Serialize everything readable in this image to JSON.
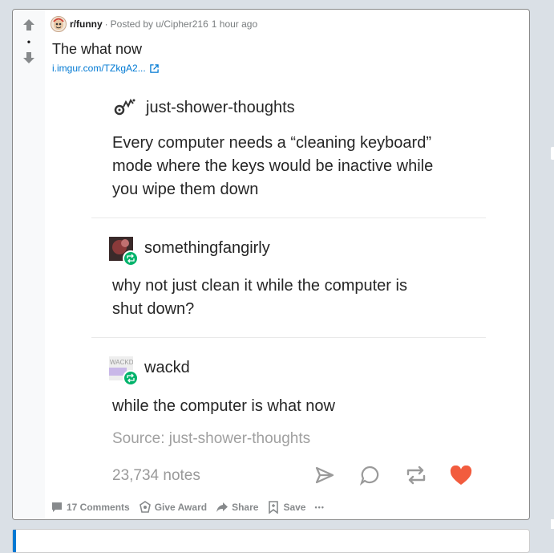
{
  "post": {
    "subreddit": "r/funny",
    "posted_by": "Posted by u/Cipher216",
    "time": "1 hour ago",
    "title": "The what now",
    "link_text": "i.imgur.com/TZkgA2...",
    "vote_count": "•"
  },
  "image_post": {
    "op": {
      "author": "just-shower-thoughts",
      "text_lines": [
        "Every computer needs a “cleaning keyboard”",
        "mode where the keys would be inactive while",
        "you wipe them down"
      ]
    },
    "reblog1": {
      "author": "somethingfangirly",
      "text_lines": [
        "why not just clean it while the computer is",
        "shut down?"
      ]
    },
    "reblog2": {
      "author": "wackd",
      "avatar_text": "WACKD",
      "text_lines": [
        "while the computer is what now"
      ]
    },
    "source": "Source: just-shower-thoughts",
    "notes": "23,734 notes"
  },
  "footer": {
    "comments": "17 Comments",
    "award": "Give Award",
    "share": "Share",
    "save": "Save",
    "more": "•••"
  },
  "colors": {
    "heart": "#f25c3e",
    "reblog_badge": "#00b36b",
    "link": "#0079d3"
  }
}
